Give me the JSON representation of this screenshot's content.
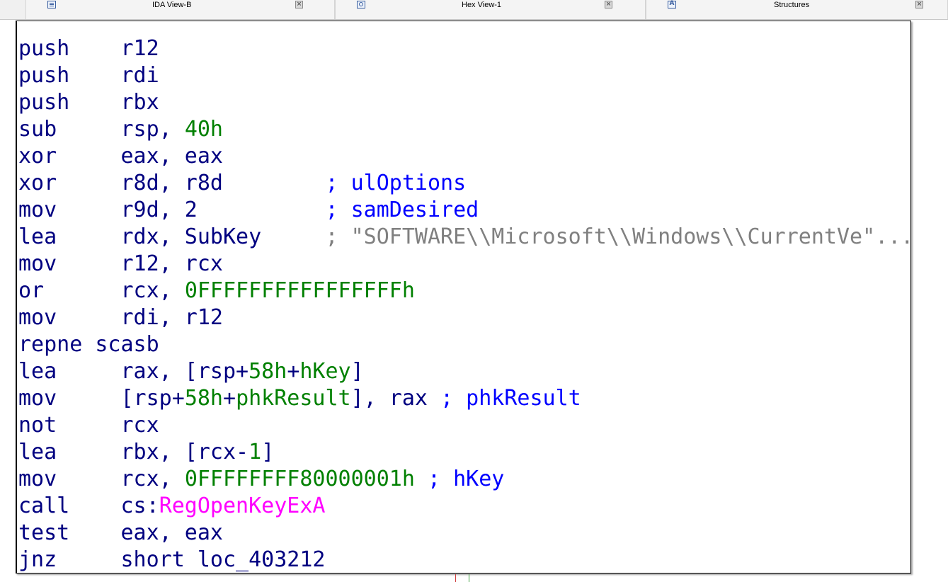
{
  "tabs": [
    {
      "label": "IDA View-B",
      "icon": "text-view-icon",
      "close": "×"
    },
    {
      "label": "Hex View-1",
      "icon": "hex-view-icon",
      "close": "×"
    },
    {
      "label": "Structures",
      "icon": "structures-icon",
      "close": "×"
    }
  ],
  "colors": {
    "mnemonic": "#000080",
    "number": "#008000",
    "comment": "#0000ff",
    "string_comment": "#808080",
    "import": "#ff00ff"
  },
  "code": {
    "lines": [
      {
        "mn": "push",
        "ops": "r12"
      },
      {
        "mn": "push",
        "ops": "rdi"
      },
      {
        "mn": "push",
        "ops": "rbx"
      },
      {
        "mn": "sub",
        "ops": "rsp, ",
        "num": "40h"
      },
      {
        "mn": "xor",
        "ops": "eax, eax"
      },
      {
        "mn": "xor",
        "ops": "r8d, r8d",
        "comment": "; ulOptions"
      },
      {
        "mn": "mov",
        "ops": "r9d, 2",
        "comment": "; samDesired"
      },
      {
        "mn": "lea",
        "ops": "rdx, SubKey",
        "str_comment": "; \"SOFTWARE\\\\Microsoft\\\\Windows\\\\CurrentVe\"..."
      },
      {
        "mn": "mov",
        "ops": "r12, rcx"
      },
      {
        "mn": "or",
        "ops": "rcx, ",
        "num": "0FFFFFFFFFFFFFFFFh"
      },
      {
        "mn": "mov",
        "ops": "rdi, r12"
      },
      {
        "mn": "repne scasb",
        "ops": ""
      },
      {
        "mn": "lea",
        "ops_a": "rax, [rsp+",
        "num": "58h",
        "ops_b": "+",
        "num2": "hKey",
        "ops_c": "]"
      },
      {
        "mn": "mov",
        "ops_a": "[rsp+",
        "num": "58h",
        "ops_b": "+",
        "num2": "phkResult",
        "ops_c": "], rax ",
        "comment": "; phkResult"
      },
      {
        "mn": "not",
        "ops": "rcx"
      },
      {
        "mn": "lea",
        "ops_a": "rbx, [rcx-",
        "num": "1",
        "ops_c": "]"
      },
      {
        "mn": "mov",
        "ops": "rcx, ",
        "num": "0FFFFFFFF80000001h",
        "comment": " ; hKey"
      },
      {
        "mn": "call",
        "ops": "cs:",
        "import": "RegOpenKeyExA"
      },
      {
        "mn": "test",
        "ops": "eax, eax"
      },
      {
        "mn": "jnz",
        "ops": "short loc_403212"
      }
    ]
  }
}
